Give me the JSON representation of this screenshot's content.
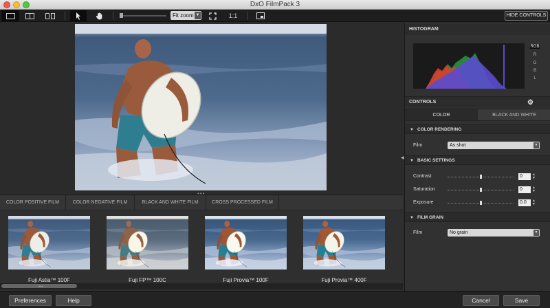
{
  "window": {
    "title": "DxO FilmPack 3"
  },
  "toolbar": {
    "fit_zoom": "Fit zoom",
    "one_to_one": "1:1",
    "hide_controls": "HIDE CONTROLS"
  },
  "film_tabs": [
    {
      "label": "COLOR POSITIVE FILM",
      "active": true
    },
    {
      "label": "COLOR NEGATIVE FILM",
      "active": false
    },
    {
      "label": "BLACK AND WHITE FILM",
      "active": false
    },
    {
      "label": "CROSS PROCESSED FILM",
      "active": false
    }
  ],
  "thumbnails": [
    {
      "caption": "Fuji Astia™ 100F"
    },
    {
      "caption": "Fuji FP™ 100C"
    },
    {
      "caption": "Fuji Provia™ 100F"
    },
    {
      "caption": "Fuji Provia™ 400F"
    }
  ],
  "histogram": {
    "title": "HISTOGRAM",
    "channels": [
      "RGB",
      "R",
      "G",
      "B",
      "L"
    ],
    "selected_channel": "RGB"
  },
  "controls": {
    "title": "CONTROLS",
    "tabs": [
      {
        "label": "COLOR",
        "active": true
      },
      {
        "label": "BLACK AND WHITE",
        "active": false
      }
    ],
    "color_rendering": {
      "title": "COLOR RENDERING",
      "film_label": "Film",
      "film_value": "As shot"
    },
    "basic_settings": {
      "title": "BASIC SETTINGS",
      "contrast_label": "Contrast",
      "contrast_value": "0",
      "saturation_label": "Saturation",
      "saturation_value": "0",
      "exposure_label": "Exposure",
      "exposure_value": "0.0"
    },
    "film_grain": {
      "title": "FILM GRAIN",
      "film_label": "Film",
      "film_value": "No grain"
    }
  },
  "bottom": {
    "preferences": "Preferences",
    "help": "Help",
    "cancel": "Cancel",
    "save": "Save"
  },
  "colors": {
    "accent_dark": "#0c0c0c",
    "panel_bg": "#313131",
    "histogram_blue": "#5a4bd0",
    "histogram_red": "#d8402e",
    "histogram_green": "#2e9a3c"
  }
}
